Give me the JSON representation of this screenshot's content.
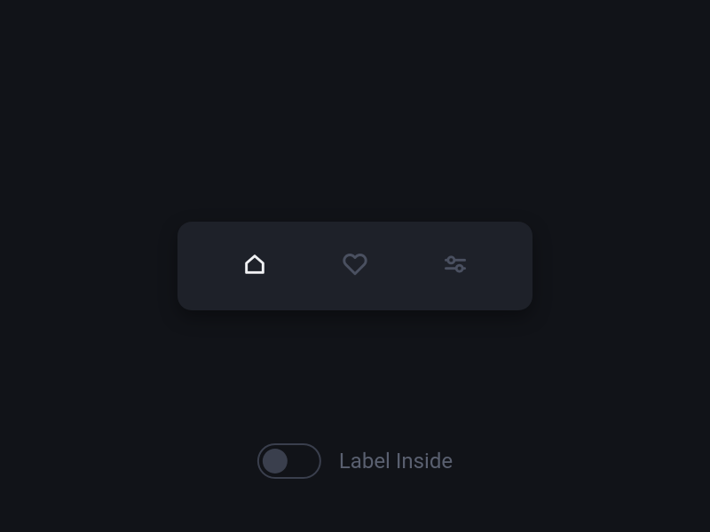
{
  "nav": {
    "items": [
      {
        "name": "home",
        "active": true
      },
      {
        "name": "heart",
        "active": false
      },
      {
        "name": "settings",
        "active": false
      }
    ]
  },
  "switch": {
    "label": "Label Inside",
    "checked": false
  }
}
